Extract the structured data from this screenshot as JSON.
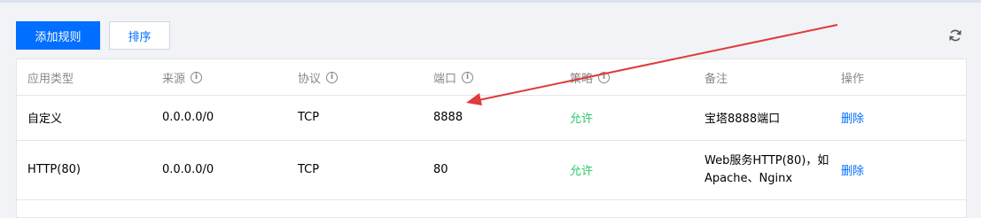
{
  "toolbar": {
    "add_rule": "添加规则",
    "sort": "排序"
  },
  "table": {
    "headers": [
      "应用类型",
      "来源",
      "协议",
      "端口",
      "策略",
      "备注",
      "操作"
    ],
    "rows": [
      {
        "app_type": "自定义",
        "source": "0.0.0.0/0",
        "protocol": "TCP",
        "port": "8888",
        "policy": "允许",
        "note": "宝塔8888端口",
        "action": "删除"
      },
      {
        "app_type": "HTTP(80)",
        "source": "0.0.0.0/0",
        "protocol": "TCP",
        "port": "80",
        "policy": "允许",
        "note_line1": "Web服务HTTP(80)，如",
        "note_line2": "Apache、Nginx",
        "action": "删除"
      }
    ]
  },
  "icons": {
    "info": "info-circle-icon",
    "refresh": "refresh-icon"
  },
  "colors": {
    "primary": "#006eff",
    "allow": "#29cc6a",
    "annotation_arrow": "#e03a3a"
  }
}
